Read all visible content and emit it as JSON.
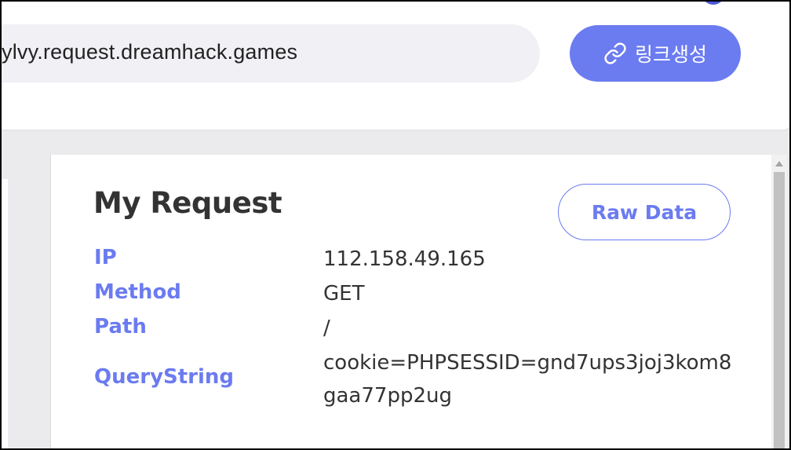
{
  "header": {
    "url_text": "ylvy.request.dreamhack.games",
    "link_button_label": "링크생성",
    "link_icon": "link-icon"
  },
  "request": {
    "title": "My Request",
    "raw_button_label": "Raw Data",
    "rows": [
      {
        "key": "IP",
        "value": "112.158.49.165"
      },
      {
        "key": "Method",
        "value": "GET"
      },
      {
        "key": "Path",
        "value": "/"
      },
      {
        "key": "QueryString",
        "value_line1": "cookie=PHPSESSID=gnd7ups3joj3kom8",
        "value_line2": "gaa77pp2ug"
      }
    ]
  },
  "colors": {
    "accent": "#6b7bf0",
    "text": "#333333",
    "background": "#ebebee"
  }
}
